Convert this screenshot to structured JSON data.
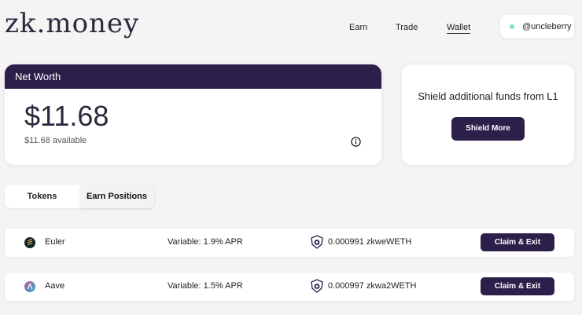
{
  "header": {
    "logo": "zk.money",
    "nav": [
      {
        "label": "Earn"
      },
      {
        "label": "Trade"
      },
      {
        "label": "Wallet"
      }
    ],
    "user": {
      "handle": "@uncleberry"
    }
  },
  "net_worth": {
    "title": "Net Worth",
    "amount": "$11.68",
    "available": "$11.68 available",
    "info_icon": "info-icon"
  },
  "shield": {
    "text": "Shield additional funds from L1",
    "button": "Shield More"
  },
  "tabs": [
    {
      "label": "Tokens",
      "active": false
    },
    {
      "label": "Earn Positions",
      "active": true
    }
  ],
  "positions": [
    {
      "asset": "Euler",
      "apr": "Variable: 1.9% APR",
      "amount": "0.000991 zkweWETH",
      "action": "Claim & Exit",
      "icon": "euler-icon"
    },
    {
      "asset": "Aave",
      "apr": "Variable: 1.5% APR",
      "amount": "0.000997 zkwa2WETH",
      "action": "Claim & Exit",
      "icon": "aave-icon"
    }
  ],
  "colors": {
    "accent": "#2c1f4a",
    "status_dot": "#7fe3c8",
    "background": "#f4f4f4"
  }
}
